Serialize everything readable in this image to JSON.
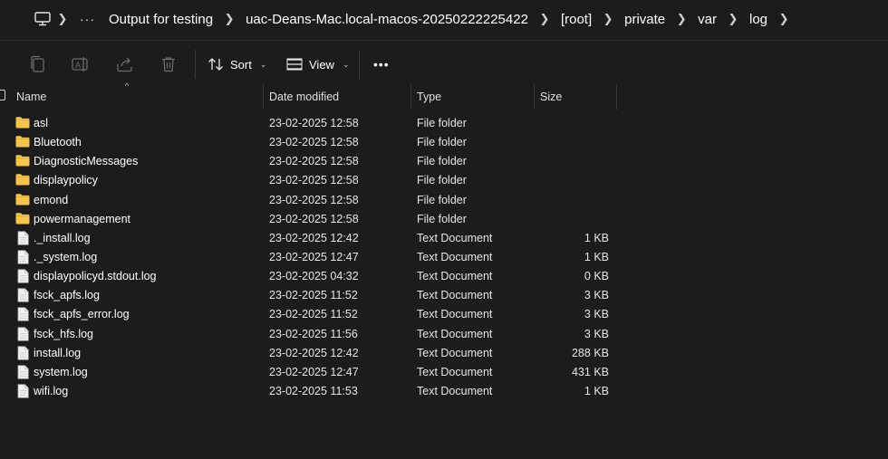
{
  "breadcrumbs": {
    "overflow": "···",
    "items": [
      "Output for testing",
      "uac-Deans-Mac.local-macos-20250222225422",
      "[root]",
      "private",
      "var",
      "log"
    ]
  },
  "commands": {
    "sort_label": "Sort",
    "view_label": "View",
    "more_label": "•••"
  },
  "columns": {
    "name": "Name",
    "date": "Date modified",
    "type": "Type",
    "size": "Size"
  },
  "files": [
    {
      "name": "asl",
      "date": "23-02-2025 12:58",
      "type": "File folder",
      "size": "",
      "kind": "folder"
    },
    {
      "name": "Bluetooth",
      "date": "23-02-2025 12:58",
      "type": "File folder",
      "size": "",
      "kind": "folder"
    },
    {
      "name": "DiagnosticMessages",
      "date": "23-02-2025 12:58",
      "type": "File folder",
      "size": "",
      "kind": "folder"
    },
    {
      "name": "displaypolicy",
      "date": "23-02-2025 12:58",
      "type": "File folder",
      "size": "",
      "kind": "folder"
    },
    {
      "name": "emond",
      "date": "23-02-2025 12:58",
      "type": "File folder",
      "size": "",
      "kind": "folder"
    },
    {
      "name": "powermanagement",
      "date": "23-02-2025 12:58",
      "type": "File folder",
      "size": "",
      "kind": "folder"
    },
    {
      "name": "._install.log",
      "date": "23-02-2025 12:42",
      "type": "Text Document",
      "size": "1 KB",
      "kind": "document"
    },
    {
      "name": "._system.log",
      "date": "23-02-2025 12:47",
      "type": "Text Document",
      "size": "1 KB",
      "kind": "document"
    },
    {
      "name": "displaypolicyd.stdout.log",
      "date": "23-02-2025 04:32",
      "type": "Text Document",
      "size": "0 KB",
      "kind": "document"
    },
    {
      "name": "fsck_apfs.log",
      "date": "23-02-2025 11:52",
      "type": "Text Document",
      "size": "3 KB",
      "kind": "document"
    },
    {
      "name": "fsck_apfs_error.log",
      "date": "23-02-2025 11:52",
      "type": "Text Document",
      "size": "3 KB",
      "kind": "document"
    },
    {
      "name": "fsck_hfs.log",
      "date": "23-02-2025 11:56",
      "type": "Text Document",
      "size": "3 KB",
      "kind": "document"
    },
    {
      "name": "install.log",
      "date": "23-02-2025 12:42",
      "type": "Text Document",
      "size": "288 KB",
      "kind": "document"
    },
    {
      "name": "system.log",
      "date": "23-02-2025 12:47",
      "type": "Text Document",
      "size": "431 KB",
      "kind": "document"
    },
    {
      "name": "wifi.log",
      "date": "23-02-2025 11:53",
      "type": "Text Document",
      "size": "1 KB",
      "kind": "document"
    }
  ],
  "colors": {
    "background": "#1c1c1c",
    "folder": "#f4c54a",
    "document_page": "#f2f2f2"
  }
}
